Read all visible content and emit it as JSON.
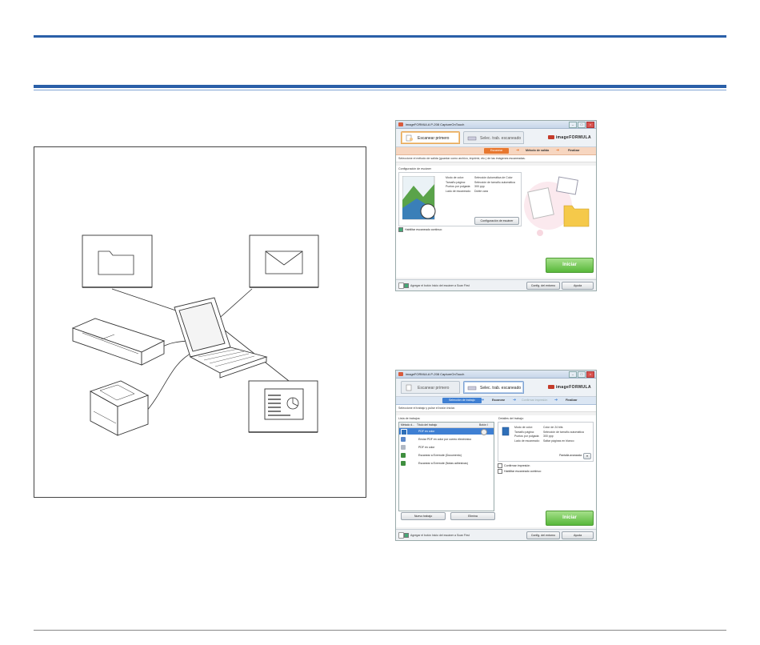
{
  "window1": {
    "title": "imageFORMULA P-208 CaptureOnTouch",
    "tab_active": "Escanear primero",
    "tab_inactive": "Selec. trab. escaneado",
    "logo": "imageFORMULA",
    "steps": [
      "Escanear",
      "Método de salida",
      "Finalizar"
    ],
    "instruction": "Seleccione el método de salida (guardar como archivo, imprimir, etc.) de las imágenes escaneadas.",
    "group_title": "Configuración de escáner",
    "settings": [
      {
        "key": "Modo de color:",
        "value": "Selección Automática de Color"
      },
      {
        "key": "Tamaño página:",
        "value": "Selección de tamaño automática"
      },
      {
        "key": "Puntos por pulgada:",
        "value": "300 ppp"
      },
      {
        "key": "Lado de escaneado:",
        "value": "Doble cara"
      }
    ],
    "config_button": "Configuración de escáner",
    "continuous_checkbox": "Habilitar escaneado continuo",
    "start_button": "Iniciar",
    "footer_checkbox": "Agregar el botón Inicio del escáner a Scan First",
    "footer_env_button": "Config. del entorno",
    "footer_help_button": "Ayuda"
  },
  "window2": {
    "title": "imageFORMULA P-208 CaptureOnTouch",
    "tab_inactive": "Escanear primero",
    "tab_active": "Selec. trab. escaneado",
    "logo": "imageFORMULA",
    "steps": [
      "Selección de trabajo",
      "Escanear",
      "Confirmar impresión",
      "Finalizar"
    ],
    "instruction": "Seleccione el trabajo y pulse el botón Iniciar.",
    "list_title": "Lista de trabajos:",
    "list_headers": [
      "Método d...",
      "Título del trabajo",
      "Botón I"
    ],
    "jobs": [
      {
        "name": "PDF en color",
        "selected": true,
        "color": "#2f6fb8"
      },
      {
        "name": "Enviar PDF en color por correo electrónico",
        "selected": false,
        "color": "#5a87c9"
      },
      {
        "name": "PDF en color",
        "selected": false,
        "color": "#b0b8c4"
      },
      {
        "name": "Escanear a Evernote (Documento)",
        "selected": false,
        "color": "#3f8f3f"
      },
      {
        "name": "Escanear a Evernote (Notas adhesivas)",
        "selected": false,
        "color": "#3f8f3f"
      }
    ],
    "new_button": "Nuevo trabajo",
    "delete_button": "Elimina",
    "details_title": "Detalles del trabajo:",
    "details": [
      {
        "key": "Modo de color:",
        "value": "Color de 24 bits"
      },
      {
        "key": "Tamaño página:",
        "value": "Selección de tamaño automática"
      },
      {
        "key": "Puntos por pulgada:",
        "value": "300 ppp"
      },
      {
        "key": "Lado de escaneado:",
        "value": "Saltar páginas en blanco"
      }
    ],
    "advanced_label": "Pantalla avanzada",
    "confirm_checkbox": "Confirmar impresión",
    "continuous_checkbox": "Habilitar escaneado continuo",
    "start_button": "Iniciar",
    "footer_checkbox": "Agregar el botón Inicio del escáner a Scan First",
    "footer_env_button": "Config. del entorno",
    "footer_help_button": "Ayuda"
  }
}
